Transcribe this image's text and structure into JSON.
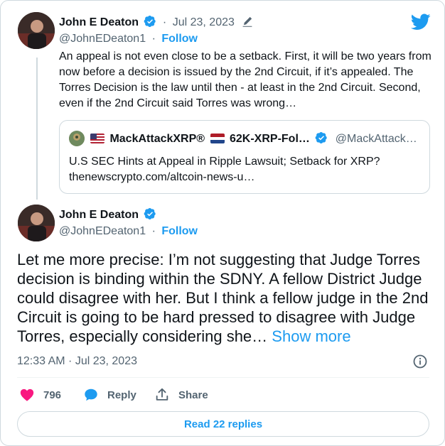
{
  "parent_tweet": {
    "author_name": "John E Deaton",
    "handle": "@JohnEDeaton1",
    "follow_label": "Follow",
    "date": "Jul 23, 2023",
    "text": "An appeal is not even close to be a setback. First, it will be two years from now before a decision is issued by the 2nd Circuit, if it’s appealed. The Torres Decision is the law until then - at least in the 2nd Circuit. Second, even if the 2nd Circuit said Torres was wrong…",
    "quote": {
      "author_name": "MackAttackXRP®",
      "author_name_2": "62K-XRP-Fol…",
      "handle": "@MackAttack…",
      "text_line1": "U.S SEC Hints at Appeal in Ripple Lawsuit; Setback for XRP?",
      "text_line2": "thenewscrypto.com/altcoin-news-u…"
    }
  },
  "main_tweet": {
    "author_name": "John E Deaton",
    "handle": "@JohnEDeaton1",
    "follow_label": "Follow",
    "text": "Let me more precise: I’m not suggesting that Judge Torres decision is binding within the SDNY. A fellow District Judge could disagree with her. But I think a fellow judge in the 2nd Circuit is going to be hard pressed to disagree with Judge Torres, especially considering she…",
    "show_more": "Show more",
    "timestamp": "12:33 AM · Jul 23, 2023"
  },
  "actions": {
    "likes": "796",
    "reply_label": "Reply",
    "share_label": "Share",
    "read_replies": "Read 22 replies"
  },
  "colors": {
    "accent": "#1d9bf0",
    "like": "#f91880",
    "muted": "#536471",
    "border": "#cfd9de"
  }
}
